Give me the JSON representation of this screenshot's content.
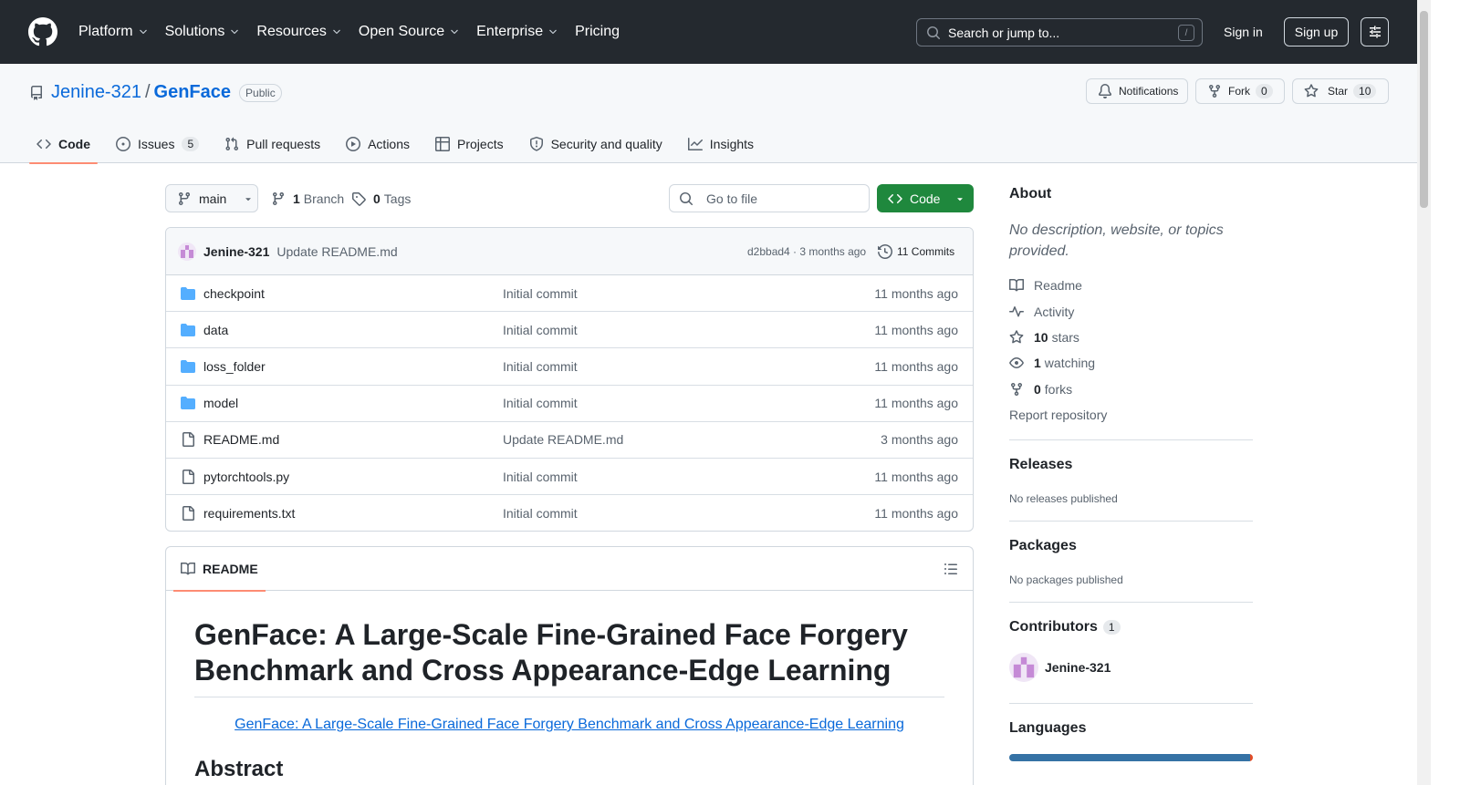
{
  "header": {
    "nav": [
      {
        "label": "Platform",
        "dropdown": true
      },
      {
        "label": "Solutions",
        "dropdown": true
      },
      {
        "label": "Resources",
        "dropdown": true
      },
      {
        "label": "Open Source",
        "dropdown": true
      },
      {
        "label": "Enterprise",
        "dropdown": true
      },
      {
        "label": "Pricing",
        "dropdown": false
      }
    ],
    "search_placeholder": "Search or jump to...",
    "search_shortcut": "/",
    "signin": "Sign in",
    "signup": "Sign up"
  },
  "repo": {
    "owner": "Jenine-321",
    "separator": "/",
    "name": "GenFace",
    "visibility": "Public",
    "notifications": "Notifications",
    "fork_label": "Fork",
    "fork_count": "0",
    "star_label": "Star",
    "star_count": "10"
  },
  "tabs": [
    {
      "label": "Code",
      "icon": "code-icon",
      "active": true,
      "count": null
    },
    {
      "label": "Issues",
      "icon": "issue-icon",
      "active": false,
      "count": "5"
    },
    {
      "label": "Pull requests",
      "icon": "pull-request-icon",
      "active": false,
      "count": null
    },
    {
      "label": "Actions",
      "icon": "play-icon",
      "active": false,
      "count": null
    },
    {
      "label": "Projects",
      "icon": "table-icon",
      "active": false,
      "count": null
    },
    {
      "label": "Security and quality",
      "icon": "shield-icon",
      "active": false,
      "count": null
    },
    {
      "label": "Insights",
      "icon": "graph-icon",
      "active": false,
      "count": null
    }
  ],
  "toolbar": {
    "branch": "main",
    "branch_count": "1",
    "branch_label": "Branch",
    "tag_count": "0",
    "tag_label": "Tags",
    "goto_placeholder": "Go to file",
    "code_button": "Code"
  },
  "latest_commit": {
    "author": "Jenine-321",
    "message": "Update README.md",
    "meta": "d2bbad4 · 3 months ago",
    "commits": "11 Commits"
  },
  "files": [
    {
      "type": "dir",
      "name": "checkpoint",
      "message": "Initial commit",
      "age": "11 months ago"
    },
    {
      "type": "dir",
      "name": "data",
      "message": "Initial commit",
      "age": "11 months ago"
    },
    {
      "type": "dir",
      "name": "loss_folder",
      "message": "Initial commit",
      "age": "11 months ago"
    },
    {
      "type": "dir",
      "name": "model",
      "message": "Initial commit",
      "age": "11 months ago"
    },
    {
      "type": "file",
      "name": "README.md",
      "message": "Update README.md",
      "age": "3 months ago"
    },
    {
      "type": "file",
      "name": "pytorchtools.py",
      "message": "Initial commit",
      "age": "11 months ago"
    },
    {
      "type": "file",
      "name": "requirements.txt",
      "message": "Initial commit",
      "age": "11 months ago"
    }
  ],
  "readme": {
    "tab": "README",
    "title": "GenFace: A Large-Scale Fine-Grained Face Forgery Benchmark and Cross Appearance-Edge Learning",
    "link": "GenFace: A Large-Scale Fine-Grained Face Forgery Benchmark and Cross Appearance-Edge Learning",
    "abstract_heading": "Abstract"
  },
  "sidebar": {
    "about_heading": "About",
    "about_desc": "No description, website, or topics provided.",
    "readme": "Readme",
    "activity": "Activity",
    "stars_count": "10",
    "stars_label": "stars",
    "watching_count": "1",
    "watching_label": "watching",
    "forks_count": "0",
    "forks_label": "forks",
    "report": "Report repository",
    "releases_heading": "Releases",
    "releases_text": "No releases published",
    "packages_heading": "Packages",
    "packages_text": "No packages published",
    "contributors_heading": "Contributors",
    "contributors_count": "1",
    "contributor_name": "Jenine-321",
    "languages_heading": "Languages",
    "language_colors": [
      "#3572A5",
      "#e34c26"
    ]
  },
  "colors": {
    "header_bg": "#24292f",
    "link": "#0969da",
    "code_button": "#1f883d",
    "active_tab_underline": "#fd8c73",
    "folder": "#54aeff"
  }
}
